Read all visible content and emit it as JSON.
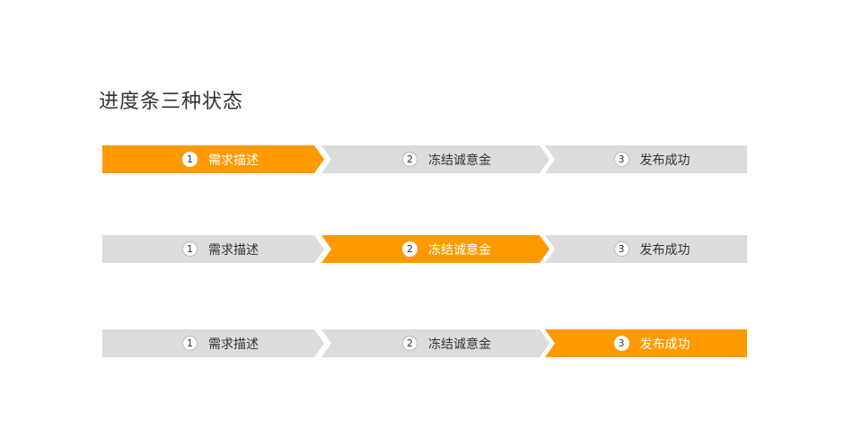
{
  "title": "进度条三种状态",
  "steps": [
    {
      "number": "1",
      "label": "需求描述"
    },
    {
      "number": "2",
      "label": "冻结诚意金"
    },
    {
      "number": "3",
      "label": "发布成功"
    }
  ],
  "progress_bars": [
    {
      "active_step": 1
    },
    {
      "active_step": 2
    },
    {
      "active_step": 3
    }
  ],
  "colors": {
    "active": "#ff9900",
    "inactive": "#dcdcdc",
    "text": "#333333",
    "active_text": "#ffffff"
  }
}
